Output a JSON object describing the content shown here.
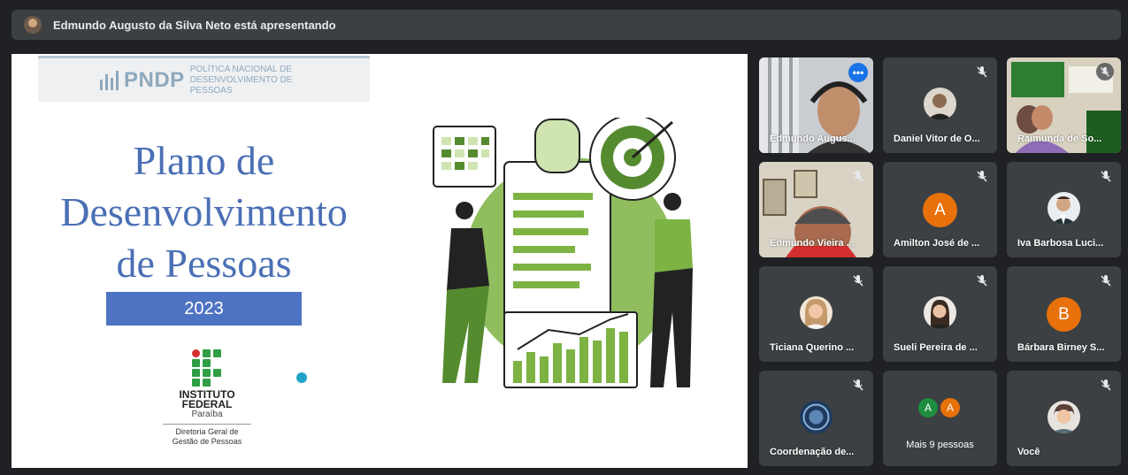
{
  "presentation_bar": {
    "text": "Edmundo Augusto da Silva Neto está apresentando"
  },
  "slide": {
    "brand": "PNDP",
    "brand_subtitle_line1": "POLÍTICA NACIONAL DE",
    "brand_subtitle_line2": "DESENVOLVIMENTO DE PESSOAS",
    "title_line1": "Plano de",
    "title_line2": "Desenvolvimento",
    "title_line3": "de Pessoas",
    "year": "2023",
    "institute_line1": "INSTITUTO",
    "institute_line2": "FEDERAL",
    "institute_state": "Paraíba",
    "department_line1": "Diretoria Geral de",
    "department_line2": "Gestão de Pessoas"
  },
  "participants": [
    {
      "name": "Edmundo Augus...",
      "type": "video",
      "active": true
    },
    {
      "name": "Daniel Vitor de O...",
      "type": "photo",
      "muted": true
    },
    {
      "name": "Raimunda de So...",
      "type": "video",
      "muted": true
    },
    {
      "name": "Edmundo Vieira ...",
      "type": "video",
      "muted": true
    },
    {
      "name": "Amilton José de ...",
      "type": "letter",
      "letter": "A",
      "muted": true
    },
    {
      "name": "Iva Barbosa Luci...",
      "type": "photo",
      "muted": true
    },
    {
      "name": "Ticiana Querino ...",
      "type": "photo",
      "muted": true
    },
    {
      "name": "Sueli Pereira de ...",
      "type": "photo",
      "muted": true
    },
    {
      "name": "Bárbara Birney S...",
      "type": "letter",
      "letter": "B",
      "muted": true
    },
    {
      "name": "Coordenação de...",
      "type": "photo",
      "muted": true
    },
    {
      "name": "Mais 9 pessoas",
      "type": "more",
      "letters": [
        "A",
        "A"
      ]
    },
    {
      "name": "Você",
      "type": "photo",
      "muted": true
    }
  ],
  "colors": {
    "background": "#202124",
    "tile": "#3c4043",
    "accent": "#8ab4f8",
    "slide_title": "#4a6fb5",
    "avatar_orange": "#e8710a",
    "illustration_green": "#7cb342"
  }
}
